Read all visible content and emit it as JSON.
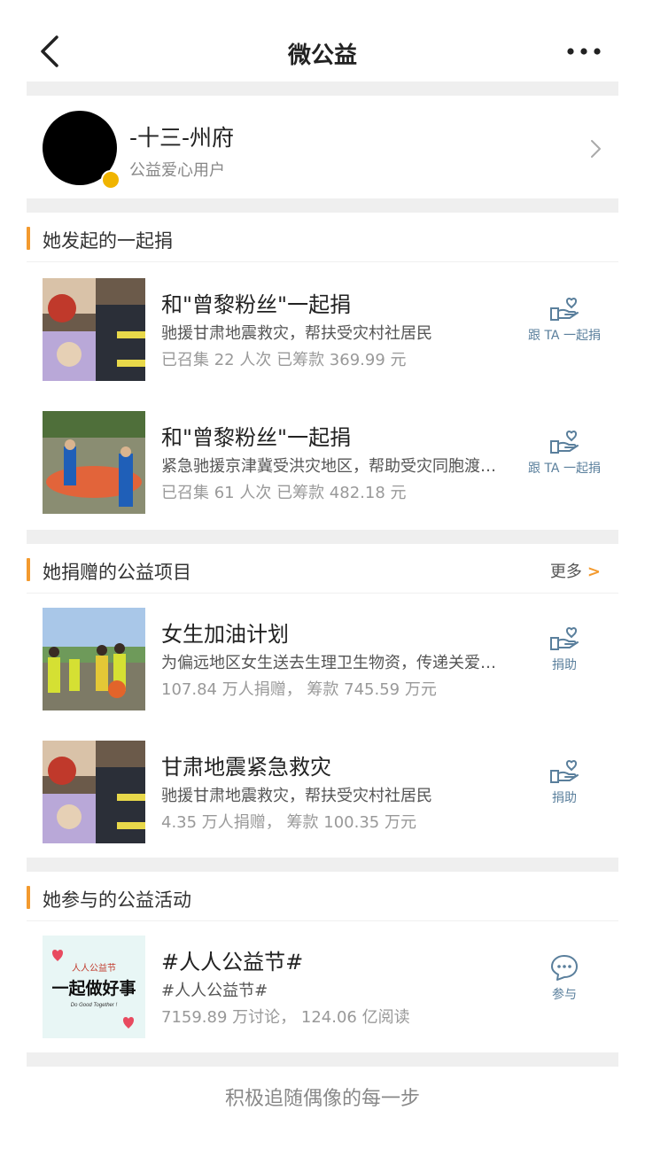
{
  "navbar": {
    "title": "微公益"
  },
  "user": {
    "name": "-十三-州府",
    "subtitle": "公益爱心用户"
  },
  "sections": {
    "initiated": {
      "title": "她发起的一起捐",
      "items": [
        {
          "title": "和\"曾黎粉丝\"一起捐",
          "desc": "驰援甘肃地震救灾，帮扶受灾村社居民",
          "stats": "已召集 22 人次 已筹款 369.99 元",
          "action": "跟 TA 一起捐",
          "icon": "hand-heart-icon"
        },
        {
          "title": "和\"曾黎粉丝\"一起捐",
          "desc": "紧急驰援京津冀受洪灾地区，帮助受灾同胞渡过难关",
          "stats": "已召集 61 人次 已筹款 482.18 元",
          "action": "跟 TA 一起捐",
          "icon": "hand-heart-icon"
        }
      ]
    },
    "donated": {
      "title": "她捐赠的公益项目",
      "more": "更多",
      "items": [
        {
          "title": "女生加油计划",
          "desc": "为偏远地区女生送去生理卫生物资，传递关爱与温暖",
          "stats": "107.84 万人捐赠， 筹款 745.59 万元",
          "action": "捐助",
          "icon": "hand-heart-icon"
        },
        {
          "title": "甘肃地震紧急救灾",
          "desc": "驰援甘肃地震救灾，帮扶受灾村社居民",
          "stats": "4.35 万人捐赠， 筹款 100.35 万元",
          "action": "捐助",
          "icon": "hand-heart-icon"
        }
      ]
    },
    "activities": {
      "title": "她参与的公益活动",
      "items": [
        {
          "title": "#人人公益节#",
          "desc": "#人人公益节#",
          "stats": "7159.89 万讨论， 124.06 亿阅读",
          "action": "参与",
          "icon": "chat-bubble-icon",
          "poster": {
            "brand": "人人公益节",
            "slogan": "一起做好事",
            "english": "Do Good Together !"
          }
        }
      ]
    }
  },
  "footer": "积极追随偶像的每一步",
  "colors": {
    "accent": "#f39a2e",
    "action": "#5a7f9c",
    "divider": "#efefef"
  }
}
